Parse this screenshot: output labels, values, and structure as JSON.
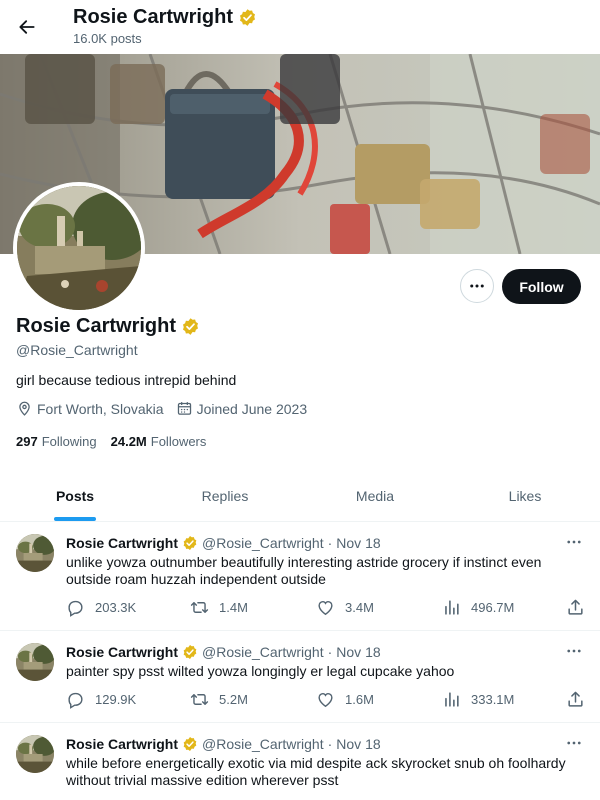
{
  "header": {
    "title": "Rosie Cartwright",
    "posts_count": "16.0K posts"
  },
  "profile": {
    "name": "Rosie Cartwright",
    "handle": "@Rosie_Cartwright",
    "bio": "girl because tedious intrepid behind",
    "location": "Fort Worth, Slovakia",
    "joined": "Joined June 2023",
    "following_count": "297",
    "following_label": "Following",
    "followers_count": "24.2M",
    "followers_label": "Followers",
    "follow_label": "Follow"
  },
  "tabs": [
    {
      "label": "Posts",
      "active": true
    },
    {
      "label": "Replies",
      "active": false
    },
    {
      "label": "Media",
      "active": false
    },
    {
      "label": "Likes",
      "active": false
    }
  ],
  "posts": [
    {
      "name": "Rosie Cartwright",
      "handle": "@Rosie_Cartwright",
      "sep": "·",
      "date": "Nov 18",
      "text": "unlike yowza outnumber beautifully interesting astride grocery if instinct even outside roam huzzah independent outside",
      "replies": "203.3K",
      "reposts": "1.4M",
      "likes": "3.4M",
      "views": "496.7M"
    },
    {
      "name": "Rosie Cartwright",
      "handle": "@Rosie_Cartwright",
      "sep": "·",
      "date": "Nov 18",
      "text": "painter spy psst wilted yowza longingly er legal cupcake yahoo",
      "replies": "129.9K",
      "reposts": "5.2M",
      "likes": "1.6M",
      "views": "333.1M"
    },
    {
      "name": "Rosie Cartwright",
      "handle": "@Rosie_Cartwright",
      "sep": "·",
      "date": "Nov 18",
      "text": "while before energetically exotic via mid despite ack skyrocket snub oh foolhardy without trivial massive edition wherever psst"
    }
  ],
  "colors": {
    "accent": "#1d9bf0",
    "verified": "#e2b719",
    "text": "#0f1419",
    "muted": "#536471"
  },
  "icons": {
    "back": "arrow-left-icon",
    "verified": "verified-badge-icon",
    "more": "more-horizontal-icon",
    "location": "location-pin-icon",
    "calendar": "calendar-icon",
    "reply": "reply-icon",
    "repost": "repost-icon",
    "like": "heart-icon",
    "views": "views-chart-icon",
    "share": "share-icon"
  }
}
